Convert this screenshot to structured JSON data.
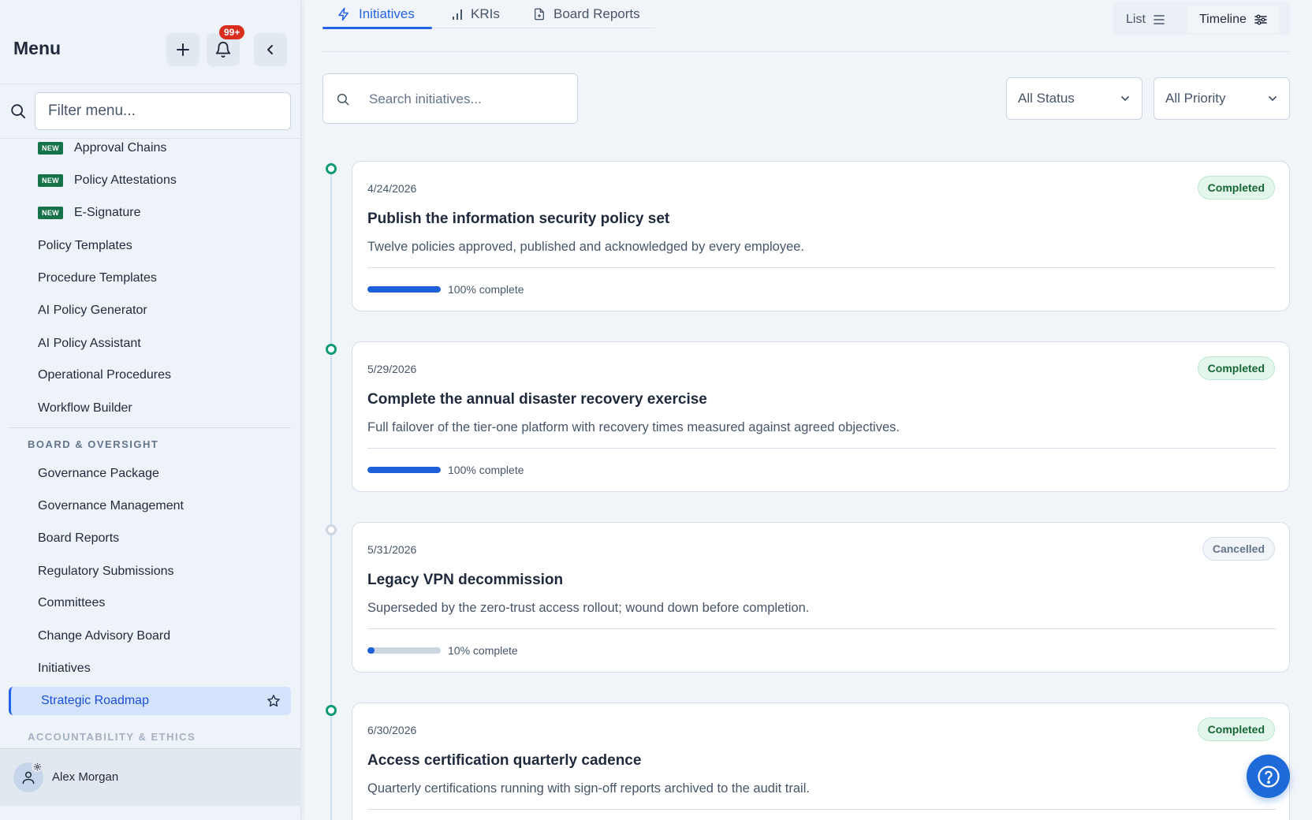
{
  "sidebar": {
    "title": "Menu",
    "notification_count": "99+",
    "filter_placeholder": "Filter menu...",
    "new_badge": "NEW",
    "items": [
      {
        "label": "Approval Chains",
        "new": true
      },
      {
        "label": "Policy Attestations",
        "new": true
      },
      {
        "label": "E-Signature",
        "new": true
      },
      {
        "label": "Policy Templates"
      },
      {
        "label": "Procedure Templates"
      },
      {
        "label": "AI Policy Generator"
      },
      {
        "label": "AI Policy Assistant"
      },
      {
        "label": "Operational Procedures"
      },
      {
        "label": "Workflow Builder"
      }
    ],
    "section_board": "BOARD & OVERSIGHT",
    "board_items": [
      {
        "label": "Governance Package"
      },
      {
        "label": "Governance Management"
      },
      {
        "label": "Board Reports"
      },
      {
        "label": "Regulatory Submissions"
      },
      {
        "label": "Committees"
      },
      {
        "label": "Change Advisory Board"
      },
      {
        "label": "Initiatives"
      }
    ],
    "active_item": "Strategic Roadmap",
    "section_next": "ACCOUNTABILITY & ETHICS",
    "user_name": "Alex Morgan"
  },
  "tabs": [
    {
      "label": "Initiatives",
      "icon": "bolt-icon",
      "active": true
    },
    {
      "label": "KRIs",
      "icon": "bar-chart-icon",
      "active": false
    },
    {
      "label": "Board Reports",
      "icon": "document-icon",
      "active": false
    }
  ],
  "view_toggle": {
    "list": "List",
    "timeline": "Timeline",
    "selected": "Timeline"
  },
  "search": {
    "placeholder": "Search initiatives..."
  },
  "filters": {
    "status": "All Status",
    "priority": "All Priority"
  },
  "initiatives": [
    {
      "date": "4/24/2026",
      "title": "Publish the information security policy set",
      "description": "Twelve policies approved, published and acknowledged by every employee.",
      "progress": 100,
      "progress_label": "100% complete",
      "status": "Completed"
    },
    {
      "date": "5/29/2026",
      "title": "Complete the annual disaster recovery exercise",
      "description": "Full failover of the tier-one platform with recovery times measured against agreed objectives.",
      "progress": 100,
      "progress_label": "100% complete",
      "status": "Completed"
    },
    {
      "date": "5/31/2026",
      "title": "Legacy VPN decommission",
      "description": "Superseded by the zero-trust access rollout; wound down before completion.",
      "progress": 10,
      "progress_label": "10% complete",
      "status": "Cancelled"
    },
    {
      "date": "6/30/2026",
      "title": "Access certification quarterly cadence",
      "description": "Quarterly certifications running with sign-off reports archived to the audit trail.",
      "status": "Completed"
    }
  ],
  "colors": {
    "accent": "#2563eb",
    "completed": "#166534",
    "timeline_dot": "#0f9b74",
    "new_badge": "#157347",
    "notification": "#d92d20"
  }
}
